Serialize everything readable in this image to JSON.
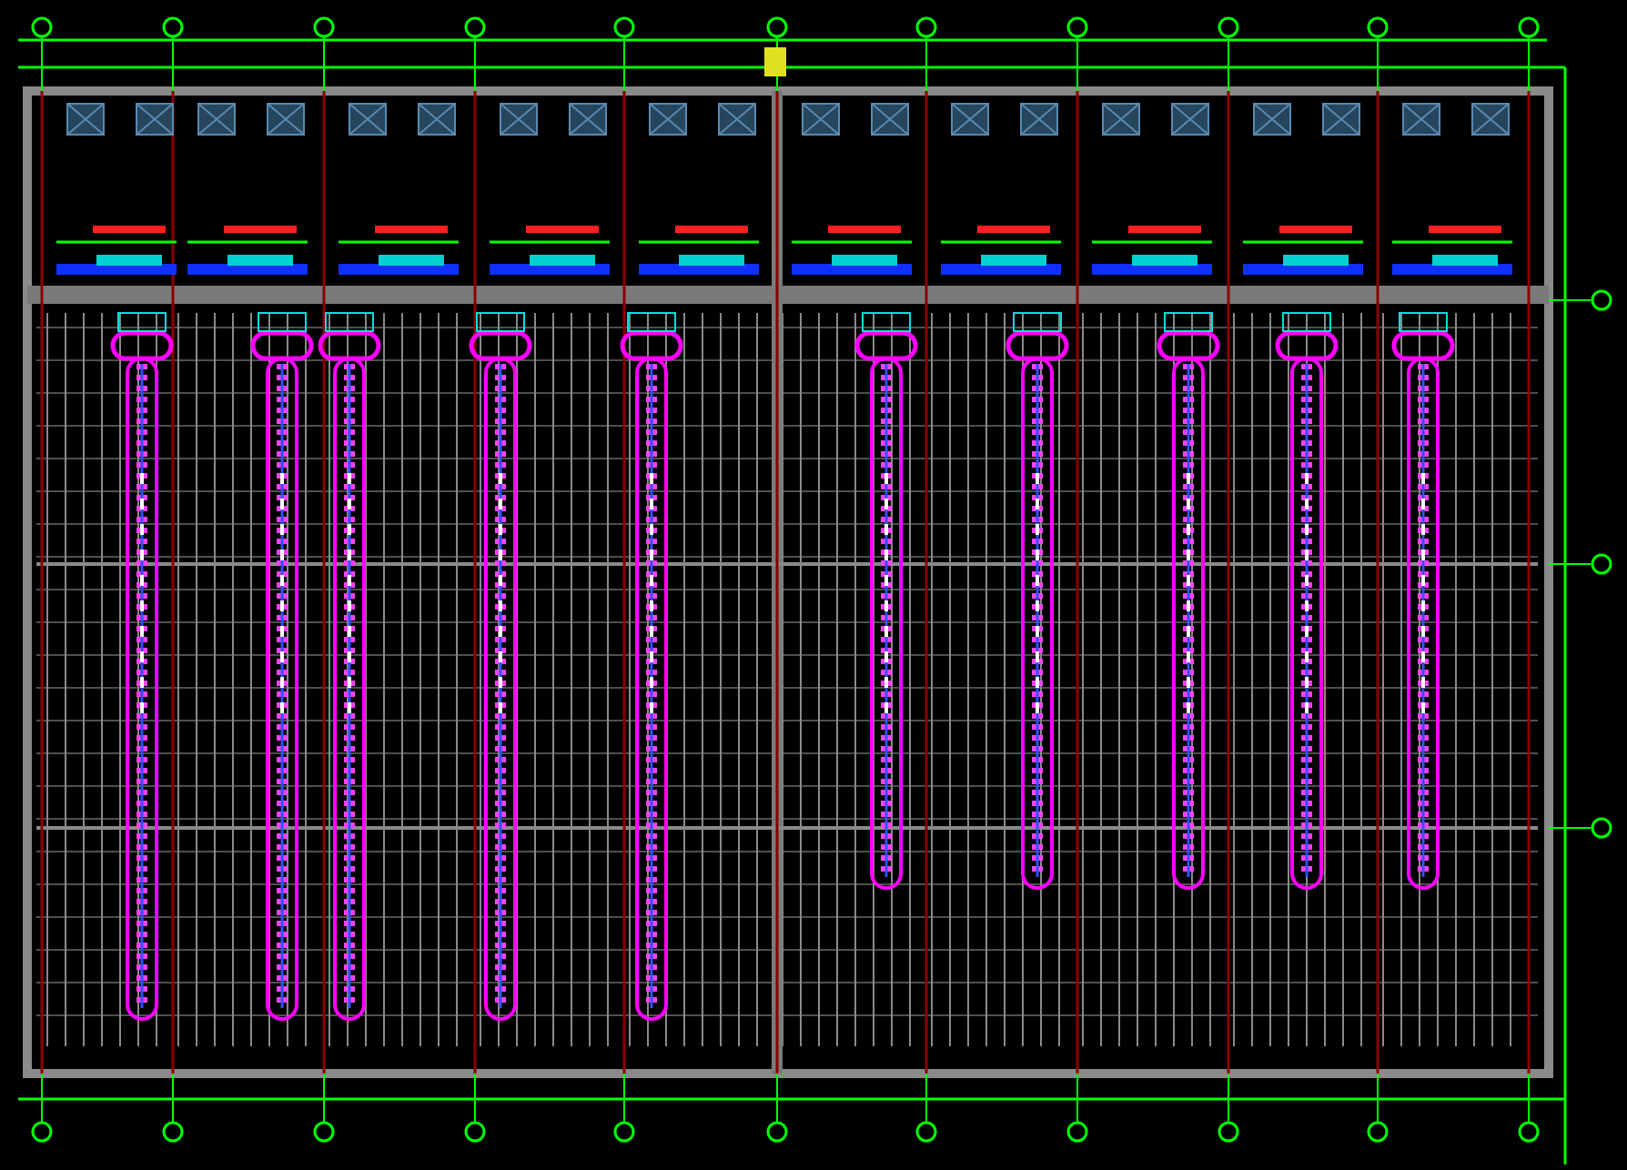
{
  "drawing": {
    "kind": "floor_plan"
  },
  "conveyors": [
    {
      "kind": "long"
    },
    {
      "kind": "long"
    },
    {
      "kind": "long"
    },
    {
      "kind": "long"
    },
    {
      "kind": "long"
    },
    {
      "kind": "short"
    },
    {
      "kind": "short"
    },
    {
      "kind": "short"
    },
    {
      "kind": "short"
    },
    {
      "kind": "short"
    }
  ]
}
